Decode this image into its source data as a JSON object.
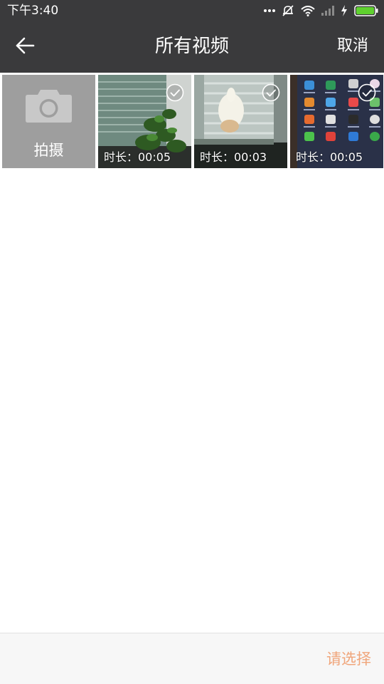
{
  "status_bar": {
    "time": "下午3:40",
    "icons": [
      "more-dots-icon",
      "alarm-off-icon",
      "wifi-icon",
      "signal-icon",
      "charging-icon",
      "battery-icon"
    ],
    "battery_color": "#5fd12f"
  },
  "header": {
    "title": "所有视频",
    "cancel_label": "取消",
    "back_icon": "arrow-left-icon",
    "background": "#3a3a3c"
  },
  "grid": {
    "shoot_tile": {
      "label": "拍摄",
      "icon": "camera-icon"
    },
    "videos": [
      {
        "duration_label": "时长：00:05",
        "selected_icon": "check-circle-icon"
      },
      {
        "duration_label": "时长：00:03",
        "selected_icon": "check-circle-icon"
      },
      {
        "duration_label": "时长：00:05",
        "selected_icon": "check-circle-icon"
      }
    ]
  },
  "footer": {
    "confirm_label": "请选择",
    "confirm_color": "#f0a57a"
  }
}
